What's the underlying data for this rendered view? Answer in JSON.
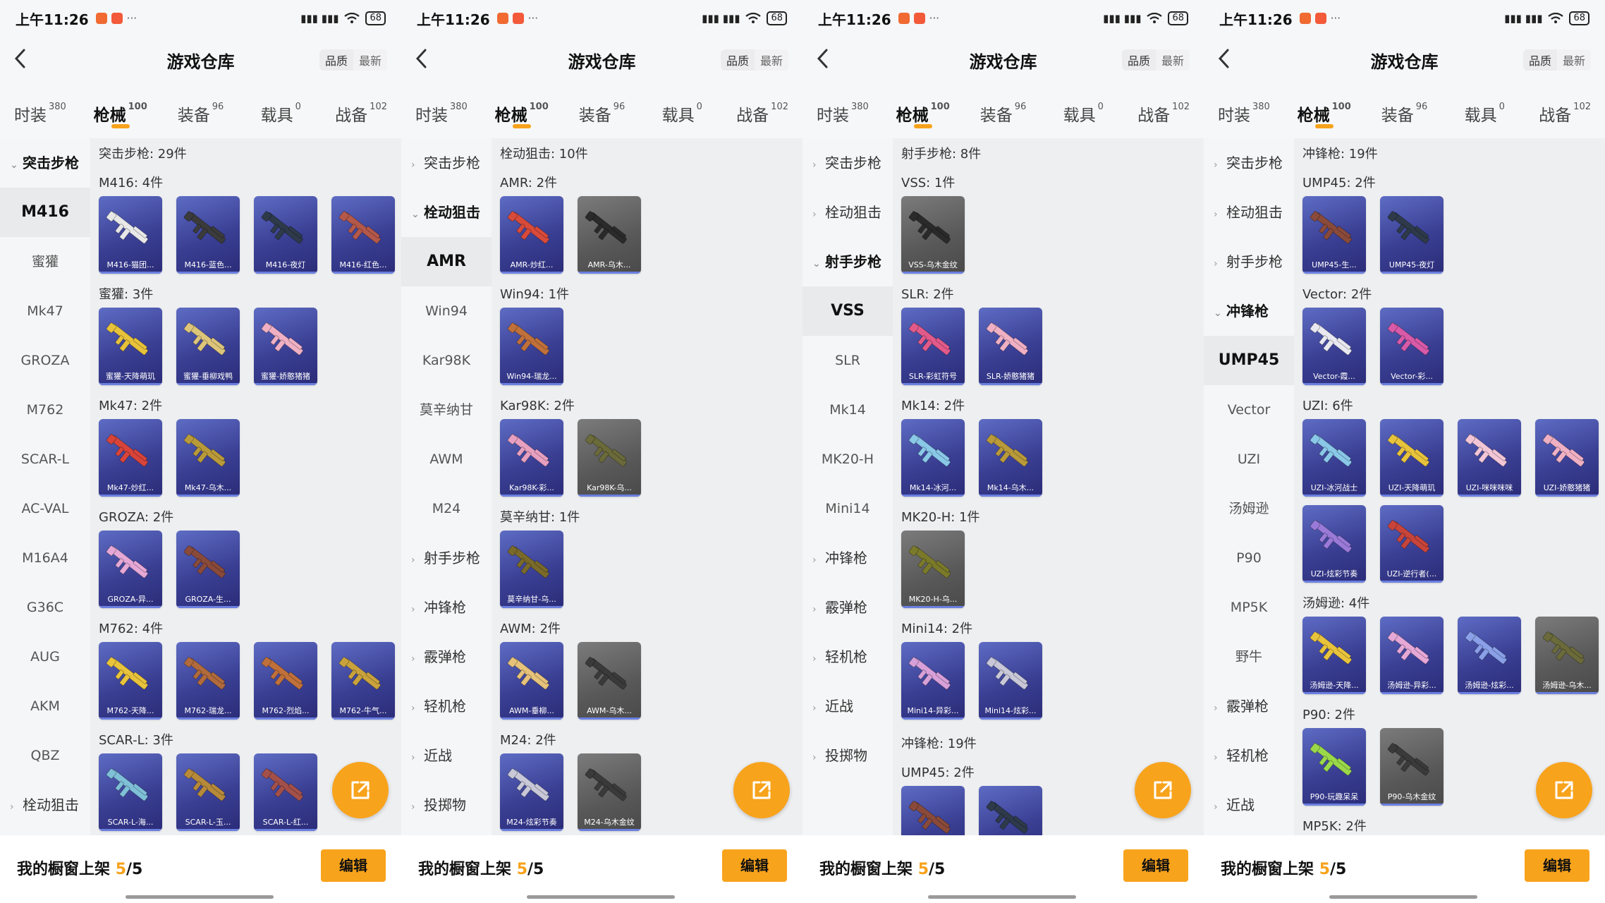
{
  "common": {
    "time": "上午11:26",
    "status_extra": "···",
    "signal": "▮▮▮ ▮▮▮",
    "battery": "68",
    "title": "游戏仓库",
    "sort_quality": "品质",
    "sort_newest": "最新",
    "shelf_label": "我的橱窗上架",
    "shelf_count": "5",
    "shelf_total": "/5",
    "edit_label": "编辑",
    "accent_color": "#f8a31c",
    "tabs": [
      {
        "label": "时装",
        "count": "380"
      },
      {
        "label": "枪械",
        "count": "100"
      },
      {
        "label": "装备",
        "count": "96"
      },
      {
        "label": "载具",
        "count": "0"
      },
      {
        "label": "战备",
        "count": "102"
      }
    ],
    "active_tab": 1
  },
  "panels": [
    {
      "sidebar": [
        {
          "label": "突击步枪",
          "type": "cat",
          "open": true
        },
        {
          "label": "M416",
          "type": "sub",
          "selected": true
        },
        {
          "label": "蜜獾",
          "type": "sub"
        },
        {
          "label": "Mk47",
          "type": "sub"
        },
        {
          "label": "GROZA",
          "type": "sub"
        },
        {
          "label": "M762",
          "type": "sub"
        },
        {
          "label": "SCAR-L",
          "type": "sub"
        },
        {
          "label": "AC-VAL",
          "type": "sub"
        },
        {
          "label": "M16A4",
          "type": "sub"
        },
        {
          "label": "G36C",
          "type": "sub"
        },
        {
          "label": "AUG",
          "type": "sub"
        },
        {
          "label": "AKM",
          "type": "sub"
        },
        {
          "label": "QBZ",
          "type": "sub"
        },
        {
          "label": "栓动狙击",
          "type": "cat"
        }
      ],
      "content": [
        {
          "total": "突击步枪: 29件"
        },
        {
          "label": "M416: 4件",
          "items": [
            {
              "name": "M416-猫团...",
              "bg": "purple",
              "tint": "#e8e8e8"
            },
            {
              "name": "M416-蓝色...",
              "bg": "purple",
              "tint": "#3b3b3b"
            },
            {
              "name": "M416-夜灯",
              "bg": "purple",
              "tint": "#2e3a4a"
            },
            {
              "name": "M416-红色...",
              "bg": "purple",
              "tint": "#b4584a"
            }
          ]
        },
        {
          "label": "蜜獾: 3件",
          "items": [
            {
              "name": "蜜獾-天降萌玑",
              "bg": "purple",
              "tint": "#e7c23a"
            },
            {
              "name": "蜜獾-垂柳戏鸭",
              "bg": "purple",
              "tint": "#dcc57a"
            },
            {
              "name": "蜜獾-娇憨猪猪",
              "bg": "purple",
              "tint": "#f0b0c4"
            }
          ]
        },
        {
          "label": "Mk47: 2件",
          "items": [
            {
              "name": "Mk47-炒红...",
              "bg": "purple",
              "tint": "#d8443a"
            },
            {
              "name": "Mk47-乌木...",
              "bg": "purple",
              "tint": "#b99a3a"
            }
          ]
        },
        {
          "label": "GROZA: 2件",
          "items": [
            {
              "name": "GROZA-异...",
              "bg": "purple",
              "tint": "#e6a8d6"
            },
            {
              "name": "GROZA-生...",
              "bg": "purple",
              "tint": "#8a4a3a"
            }
          ]
        },
        {
          "label": "M762: 4件",
          "items": [
            {
              "name": "M762-天降...",
              "bg": "purple",
              "tint": "#e8c33c"
            },
            {
              "name": "M762-瑞龙...",
              "bg": "purple",
              "tint": "#b06a3c"
            },
            {
              "name": "M762-烈焰...",
              "bg": "purple",
              "tint": "#c0703a"
            },
            {
              "name": "M762-牛气...",
              "bg": "purple",
              "tint": "#c9a23c"
            }
          ]
        },
        {
          "label": "SCAR-L: 3件",
          "items": [
            {
              "name": "SCAR-L-海...",
              "bg": "purple",
              "tint": "#7fc0d8"
            },
            {
              "name": "SCAR-L-玉...",
              "bg": "purple",
              "tint": "#b78a3a"
            },
            {
              "name": "SCAR-L-红...",
              "bg": "purple",
              "tint": "#a4504a"
            }
          ]
        }
      ]
    },
    {
      "sidebar": [
        {
          "label": "突击步枪",
          "type": "cat"
        },
        {
          "label": "栓动狙击",
          "type": "cat",
          "open": true
        },
        {
          "label": "AMR",
          "type": "sub",
          "selected": true
        },
        {
          "label": "Win94",
          "type": "sub"
        },
        {
          "label": "Kar98K",
          "type": "sub"
        },
        {
          "label": "莫辛纳甘",
          "type": "sub"
        },
        {
          "label": "AWM",
          "type": "sub"
        },
        {
          "label": "M24",
          "type": "sub"
        },
        {
          "label": "射手步枪",
          "type": "cat"
        },
        {
          "label": "冲锋枪",
          "type": "cat"
        },
        {
          "label": "霰弹枪",
          "type": "cat"
        },
        {
          "label": "轻机枪",
          "type": "cat"
        },
        {
          "label": "近战",
          "type": "cat"
        },
        {
          "label": "投掷物",
          "type": "cat"
        }
      ],
      "content": [
        {
          "total": "栓动狙击: 10件"
        },
        {
          "label": "AMR: 2件",
          "items": [
            {
              "name": "AMR-炒红...",
              "bg": "purple",
              "tint": "#d84a3a"
            },
            {
              "name": "AMR-乌木...",
              "bg": "gray",
              "tint": "#2a2a2a"
            }
          ]
        },
        {
          "label": "Win94: 1件",
          "items": [
            {
              "name": "Win94-瑞龙...",
              "bg": "purple",
              "tint": "#c0703a"
            }
          ]
        },
        {
          "label": "Kar98K: 2件",
          "items": [
            {
              "name": "Kar98K-彩...",
              "bg": "purple",
              "tint": "#e8a0c0"
            },
            {
              "name": "Kar98K-乌...",
              "bg": "gray",
              "tint": "#6a6a3a"
            }
          ]
        },
        {
          "label": "莫辛纳甘: 1件",
          "items": [
            {
              "name": "莫辛纳甘-乌...",
              "bg": "purple",
              "tint": "#7a6a2a"
            }
          ]
        },
        {
          "label": "AWM: 2件",
          "items": [
            {
              "name": "AWM-垂柳...",
              "bg": "purple",
              "tint": "#e6c27a"
            },
            {
              "name": "AWM-乌木...",
              "bg": "gray",
              "tint": "#3a3a3a"
            }
          ]
        },
        {
          "label": "M24: 2件",
          "items": [
            {
              "name": "M24-炫彩节奏",
              "bg": "purple",
              "tint": "#c8c8d8"
            },
            {
              "name": "M24-乌木金纹",
              "bg": "gray",
              "tint": "#3a3a3a"
            }
          ]
        }
      ]
    },
    {
      "sidebar": [
        {
          "label": "突击步枪",
          "type": "cat"
        },
        {
          "label": "栓动狙击",
          "type": "cat"
        },
        {
          "label": "射手步枪",
          "type": "cat",
          "open": true
        },
        {
          "label": "VSS",
          "type": "sub",
          "selected": true
        },
        {
          "label": "SLR",
          "type": "sub"
        },
        {
          "label": "Mk14",
          "type": "sub"
        },
        {
          "label": "MK20-H",
          "type": "sub"
        },
        {
          "label": "Mini14",
          "type": "sub"
        },
        {
          "label": "冲锋枪",
          "type": "cat"
        },
        {
          "label": "霰弹枪",
          "type": "cat"
        },
        {
          "label": "轻机枪",
          "type": "cat"
        },
        {
          "label": "近战",
          "type": "cat"
        },
        {
          "label": "投掷物",
          "type": "cat"
        }
      ],
      "content": [
        {
          "total": "射手步枪: 8件"
        },
        {
          "label": "VSS: 1件",
          "items": [
            {
              "name": "VSS-乌木金纹",
              "bg": "gray",
              "tint": "#2a2a2a"
            }
          ]
        },
        {
          "label": "SLR: 2件",
          "items": [
            {
              "name": "SLR-彩虹符号",
              "bg": "purple",
              "tint": "#e25a8a"
            },
            {
              "name": "SLR-娇憨猪猪",
              "bg": "purple",
              "tint": "#f0b0c4"
            }
          ]
        },
        {
          "label": "Mk14: 2件",
          "items": [
            {
              "name": "Mk14-冰河...",
              "bg": "purple",
              "tint": "#8ac8e8"
            },
            {
              "name": "Mk14-乌木...",
              "bg": "purple",
              "tint": "#b99a3a"
            }
          ]
        },
        {
          "label": "MK20-H: 1件",
          "items": [
            {
              "name": "MK20-H-乌...",
              "bg": "gray",
              "tint": "#7a7a2a"
            }
          ]
        },
        {
          "label": "Mini14: 2件",
          "items": [
            {
              "name": "Mini14-异彩...",
              "bg": "purple",
              "tint": "#d8a0d8"
            },
            {
              "name": "Mini14-炫彩...",
              "bg": "purple",
              "tint": "#c8c8d8"
            }
          ]
        },
        {
          "total": "冲锋枪: 19件"
        },
        {
          "label": "UMP45: 2件",
          "items": [
            {
              "name": "UMP45-生...",
              "bg": "purple",
              "tint": "#8a4a3a"
            },
            {
              "name": "UMP45-夜灯",
              "bg": "purple",
              "tint": "#2e3a4a"
            }
          ]
        }
      ]
    },
    {
      "sidebar": [
        {
          "label": "突击步枪",
          "type": "cat"
        },
        {
          "label": "栓动狙击",
          "type": "cat"
        },
        {
          "label": "射手步枪",
          "type": "cat"
        },
        {
          "label": "冲锋枪",
          "type": "cat",
          "open": true
        },
        {
          "label": "UMP45",
          "type": "sub",
          "selected": true
        },
        {
          "label": "Vector",
          "type": "sub"
        },
        {
          "label": "UZI",
          "type": "sub"
        },
        {
          "label": "汤姆逊",
          "type": "sub"
        },
        {
          "label": "P90",
          "type": "sub"
        },
        {
          "label": "MP5K",
          "type": "sub"
        },
        {
          "label": "野牛",
          "type": "sub"
        },
        {
          "label": "霰弹枪",
          "type": "cat"
        },
        {
          "label": "轻机枪",
          "type": "cat"
        },
        {
          "label": "近战",
          "type": "cat"
        }
      ],
      "content": [
        {
          "total": "冲锋枪: 19件"
        },
        {
          "label": "UMP45: 2件",
          "items": [
            {
              "name": "UMP45-生...",
              "bg": "purple",
              "tint": "#8a4a3a"
            },
            {
              "name": "UMP45-夜灯",
              "bg": "purple",
              "tint": "#2e3a4a"
            }
          ]
        },
        {
          "label": "Vector: 2件",
          "items": [
            {
              "name": "Vector-霞...",
              "bg": "purple",
              "tint": "#e8e8f0"
            },
            {
              "name": "Vector-彩...",
              "bg": "purple",
              "tint": "#d85aa8"
            }
          ]
        },
        {
          "label": "UZI: 6件",
          "items": [
            {
              "name": "UZI-冰河战士",
              "bg": "purple",
              "tint": "#8ac8e8"
            },
            {
              "name": "UZI-天降萌玑",
              "bg": "purple",
              "tint": "#e8c33c"
            },
            {
              "name": "UZI-咪咪咪咪",
              "bg": "purple",
              "tint": "#f2c6d6"
            },
            {
              "name": "UZI-娇憨猪猪",
              "bg": "purple",
              "tint": "#f0b0c4"
            },
            {
              "name": "UZI-炫彩节奏",
              "bg": "purple",
              "tint": "#9a7ad8"
            },
            {
              "name": "UZI-逆行者(...",
              "bg": "purple",
              "tint": "#c8443a"
            }
          ]
        },
        {
          "label": "汤姆逊: 4件",
          "items": [
            {
              "name": "汤姆逊-天降...",
              "bg": "purple",
              "tint": "#e8c33c"
            },
            {
              "name": "汤姆逊-异彩...",
              "bg": "purple",
              "tint": "#e6a8d6"
            },
            {
              "name": "汤姆逊-炫彩...",
              "bg": "purple",
              "tint": "#8aa0e8"
            },
            {
              "name": "汤姆逊-乌木...",
              "bg": "gray",
              "tint": "#6a6a3a"
            }
          ]
        },
        {
          "label": "P90: 2件",
          "items": [
            {
              "name": "P90-玩趣呆呆",
              "bg": "purple",
              "tint": "#9ad84a"
            },
            {
              "name": "P90-乌木金纹",
              "bg": "gray",
              "tint": "#3a3a3a"
            }
          ]
        },
        {
          "label": "MP5K: 2件",
          "items": []
        }
      ]
    }
  ]
}
